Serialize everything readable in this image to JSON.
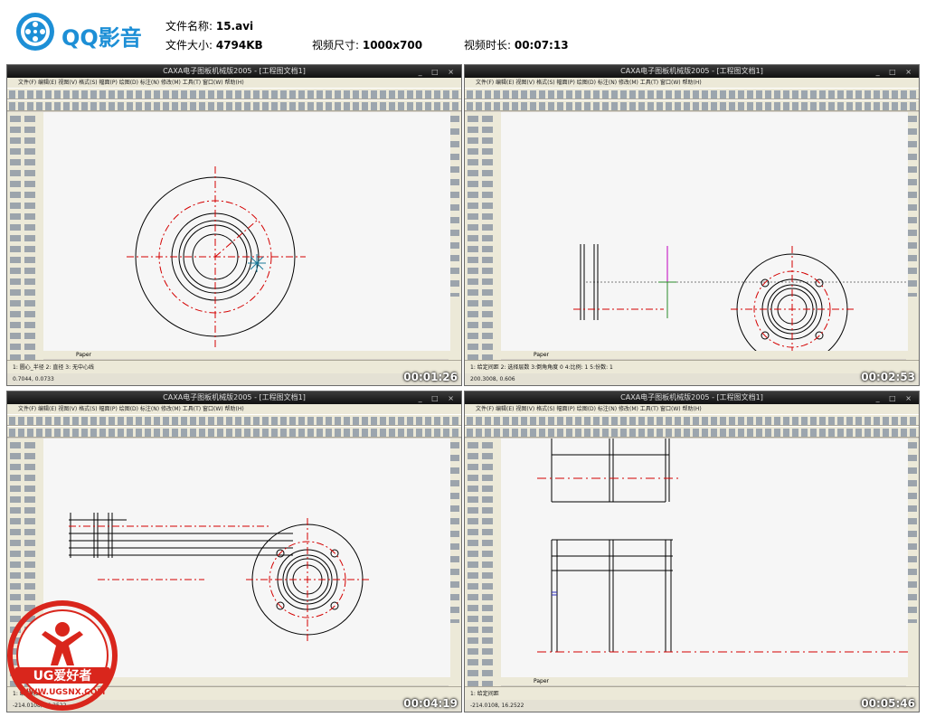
{
  "header": {
    "app_name": "QQ影音",
    "file_name_label": "文件名称: ",
    "file_name": "15.avi",
    "file_size_label": "文件大小: ",
    "file_size": "4794KB",
    "video_size_label": "视频尺寸: ",
    "video_size": "1000x700",
    "duration_label": "视频时长: ",
    "duration": "00:07:13"
  },
  "window": {
    "title": "CAXA电子图板机械版2005 - [工程图文档1]",
    "menus": "文件(F)  编辑(E)  视图(V)  格式(S)  幅面(P)  绘图(D)  标注(N)  修改(M)  工具(T)  窗口(W)  帮助(H)",
    "layer_label": "ByLayer",
    "layout_tab": "Paper"
  },
  "frames": [
    {
      "timestamp": "00:01:26",
      "command": "1: 圆心_半径   2: 直径   3: 无中心线",
      "status": "0.7044, 0.0733"
    },
    {
      "timestamp": "00:02:53",
      "command": "1: 给定间距   2: 选择层数   3:倒角角度 0   4:比例: 1   5:份数: 1",
      "status": "200.3008, 0.606"
    },
    {
      "timestamp": "00:04:19",
      "command": "1: 给定间距",
      "status": "-214.0108, 16.2522"
    },
    {
      "timestamp": "00:05:46",
      "command": "1: 给定间距",
      "status": "-214.0108, 16.2522"
    }
  ],
  "watermark": {
    "brand": "UG爱好者",
    "url": "WWW.UGSNX.COM"
  },
  "colors": {
    "accent": "#1d8fd6",
    "center_line": "#d40000",
    "watermark_red": "#d9261c"
  }
}
